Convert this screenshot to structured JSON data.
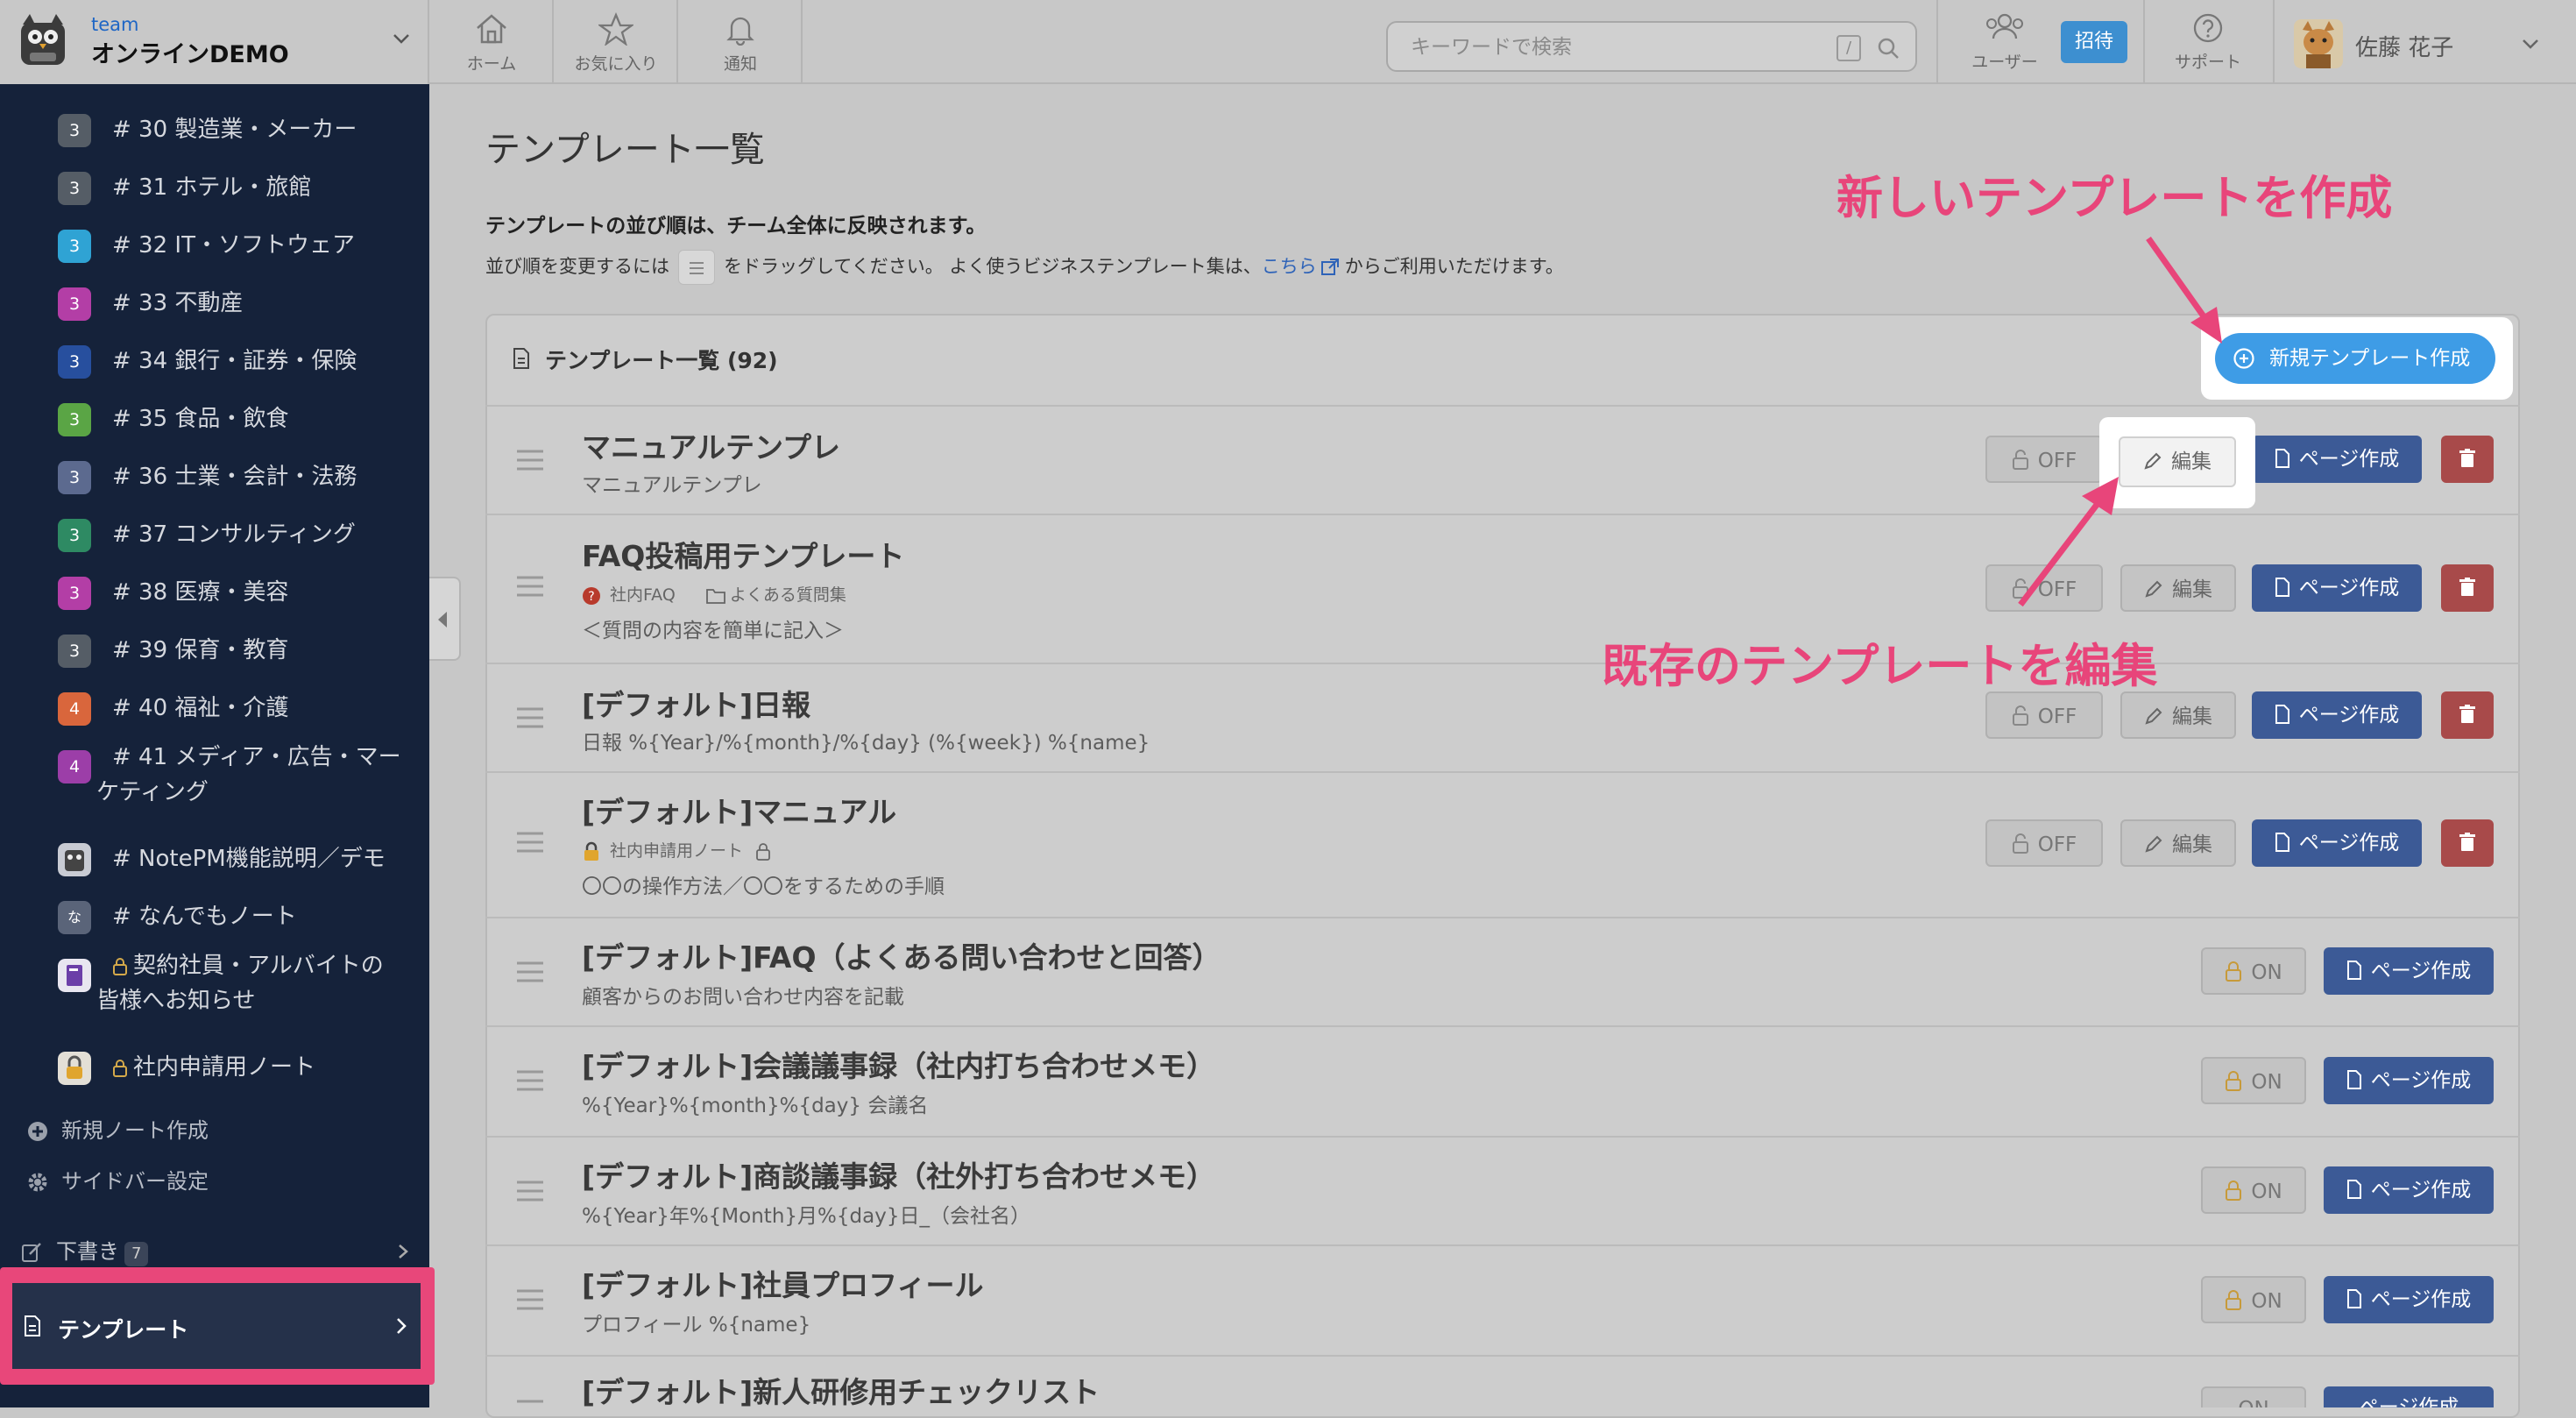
{
  "header": {
    "team_label": "team",
    "team_name": "オンラインDEMO",
    "nav": {
      "home": "ホーム",
      "favorites": "お気に入り",
      "notifications": "通知"
    },
    "search_placeholder": "キーワードで検索",
    "search_shortcut": "/",
    "users_label": "ユーザー",
    "invite_label": "招待",
    "support_label": "サポート",
    "user_name": "佐藤 花子"
  },
  "sidebar": {
    "items": [
      {
        "badge": "3",
        "color": "#555d66",
        "label": "# 30 製造業・メーカー"
      },
      {
        "badge": "3",
        "color": "#555d66",
        "label": "# 31 ホテル・旅館"
      },
      {
        "badge": "3",
        "color": "#2fa3d4",
        "label": "# 32 IT・ソフトウェア"
      },
      {
        "badge": "3",
        "color": "#b33ea6",
        "label": "# 33 不動産"
      },
      {
        "badge": "3",
        "color": "#274f9e",
        "label": "# 34 銀行・証券・保険"
      },
      {
        "badge": "3",
        "color": "#5aa545",
        "label": "# 35 食品・飲食"
      },
      {
        "badge": "3",
        "color": "#5c6a8f",
        "label": "# 36 士業・会計・法務"
      },
      {
        "badge": "3",
        "color": "#2e8a63",
        "label": "# 37 コンサルティング"
      },
      {
        "badge": "3",
        "color": "#b33ea6",
        "label": "# 38 医療・美容"
      },
      {
        "badge": "3",
        "color": "#555d66",
        "label": "# 39 保育・教育"
      },
      {
        "badge": "4",
        "color": "#d9663c",
        "label": "# 40 福祉・介護"
      },
      {
        "badge": "4",
        "color": "#9c3ea8",
        "label": "# 41 メディア・広告・マーケティング"
      },
      {
        "badge": "",
        "color": "#c8cbd3",
        "label": "# NotePM機能説明／デモ"
      },
      {
        "badge": "な",
        "color": "#5a6479",
        "label": "# なんでもノート"
      },
      {
        "badge": "",
        "color": "#6b3fa8",
        "label": "契約社員・アルバイトの皆様へお知らせ"
      },
      {
        "badge": "",
        "color": "#e3dfd6",
        "label": "社内申請用ノート"
      }
    ],
    "new_note": "新規ノート作成",
    "settings": "サイドバー設定",
    "drafts": "下書き",
    "drafts_count": "7",
    "templates": "テンプレート"
  },
  "main": {
    "title": "テンプレート一覧",
    "notice_bold": "テンプレートの並び順は、チーム全体に反映されます。",
    "notice_pre": "並び順を変更するには",
    "notice_mid": "をドラッグしてください。 よく使うビジネステンプレート集は、",
    "notice_link": "こちら",
    "notice_post": "からご利用いただけます。",
    "panel_title": "テンプレート一覧 (92)",
    "new_button": "新規テンプレート作成",
    "labels": {
      "off": "OFF",
      "on": "ON",
      "edit": "編集",
      "create_page": "ページ作成"
    },
    "templates": [
      {
        "title": "マニュアルテンプレ",
        "desc": "マニュアルテンプレ"
      },
      {
        "title": "FAQ投稿用テンプレート",
        "meta_note": "社内FAQ",
        "meta_folder": "よくある質問集",
        "desc": "＜質問の内容を簡単に記入＞"
      },
      {
        "title": "[デフォルト]日報",
        "desc": "日報 %{Year}/%{month}/%{day} (%{week}) %{name}"
      },
      {
        "title": "[デフォルト]マニュアル",
        "meta_note": "社内申請用ノート",
        "desc": "〇〇の操作方法／〇〇をするための手順"
      },
      {
        "title": "[デフォルト]FAQ（よくある問い合わせと回答）",
        "desc": "顧客からのお問い合わせ内容を記載"
      },
      {
        "title": "[デフォルト]会議議事録（社内打ち合わせメモ）",
        "desc": "%{Year}%{month}%{day} 会議名"
      },
      {
        "title": "[デフォルト]商談議事録（社外打ち合わせメモ）",
        "desc": "%{Year}年%{Month}月%{day}日_（会社名）"
      },
      {
        "title": "[デフォルト]社員プロフィール",
        "desc": "プロフィール %{name}"
      },
      {
        "title": "[デフォルト]新人研修用チェックリスト",
        "desc": ""
      }
    ]
  },
  "annotations": {
    "new_template": "新しいテンプレートを作成",
    "edit_template": "既存のテンプレートを編集"
  },
  "colors": {
    "accent_pink": "#e8457a",
    "primary_blue": "#3e9ce6",
    "navy": "#3c5a96",
    "danger": "#a84a4a"
  }
}
